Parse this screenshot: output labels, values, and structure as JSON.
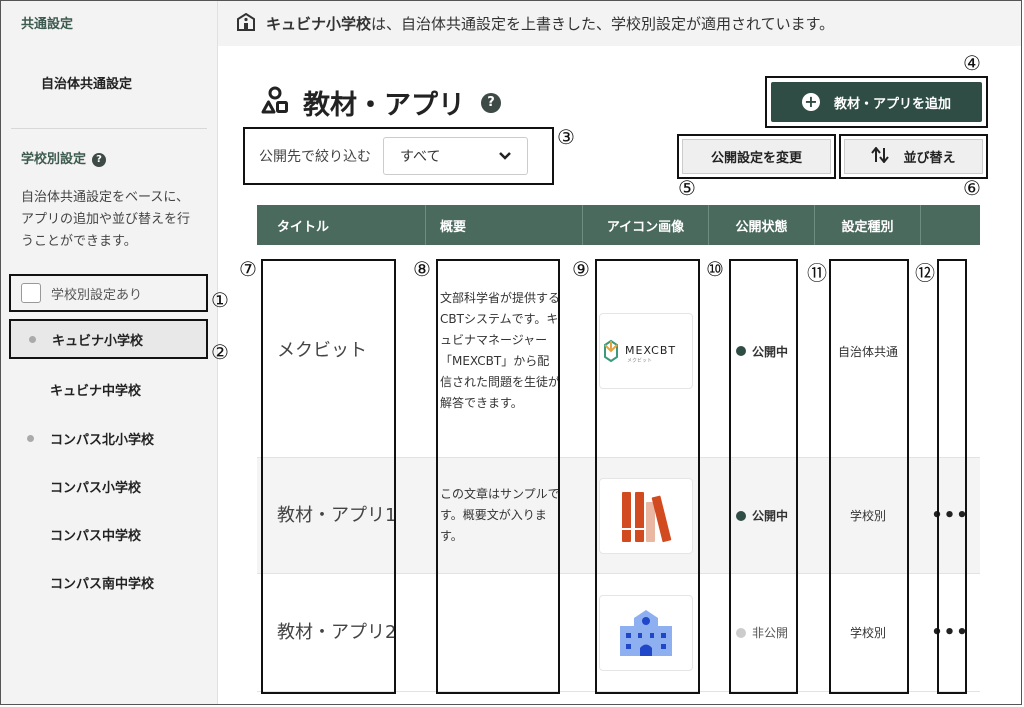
{
  "sidebar": {
    "common_title": "共通設定",
    "common_link": "自治体共通設定",
    "school_title": "学校別設定",
    "help_glyph": "?",
    "description": "自治体共通設定をベースに、アプリの追加や並び替えを行うことができます。",
    "filter_checkbox_label": "学校別設定あり",
    "schools": [
      {
        "name": "キュビナ小学校",
        "has_setting": true,
        "active": true
      },
      {
        "name": "キュビナ中学校",
        "has_setting": false,
        "active": false
      },
      {
        "name": "コンパス北小学校",
        "has_setting": true,
        "active": false
      },
      {
        "name": "コンパス小学校",
        "has_setting": false,
        "active": false
      },
      {
        "name": "コンパス中学校",
        "has_setting": false,
        "active": false
      },
      {
        "name": "コンパス南中学校",
        "has_setting": false,
        "active": false
      }
    ]
  },
  "banner": {
    "school": "キュビナ小学校",
    "message": "は、自治体共通設定を上書きした、学校別設定が適用されています。"
  },
  "page": {
    "title": "教材・アプリ",
    "help_glyph": "?"
  },
  "toolbar": {
    "add_label": "教材・アプリを追加",
    "filter_label": "公開先で絞り込む",
    "filter_value": "すべて",
    "visibility_label": "公開設定を変更",
    "sort_label": "並び替え"
  },
  "table": {
    "headers": [
      "タイトル",
      "概要",
      "アイコン画像",
      "公開状態",
      "設定種別",
      ""
    ],
    "rows": [
      {
        "title": "メクビット",
        "description": "文部科学省が提供するCBTシステムです。キュビナマネージャー「MEXCBT」から配信された問題を生徒が解答できます。",
        "icon": "mexcbt-logo-icon",
        "icon_text": "MEXCBT",
        "icon_subtext": "メクビット",
        "status": "公開中",
        "status_public": true,
        "type": "自治体共通",
        "has_menu": false
      },
      {
        "title": "教材・アプリ1",
        "description": "この文章はサンプルです。概要文が入ります。",
        "icon": "books-icon",
        "status": "公開中",
        "status_public": true,
        "type": "学校別",
        "has_menu": true
      },
      {
        "title": "教材・アプリ2",
        "description": "",
        "icon": "school-building-icon",
        "status": "非公開",
        "status_public": false,
        "type": "学校別",
        "has_menu": true
      }
    ],
    "menu_glyph": "•••"
  },
  "annotations": [
    "①",
    "②",
    "③",
    "④",
    "⑤",
    "⑥",
    "⑦",
    "⑧",
    "⑨",
    "⑩",
    "⑪",
    "⑫"
  ],
  "colors": {
    "primary": "#2f4d44",
    "header": "#4b6a5e",
    "status_public": "#2f4d44",
    "status_private": "#cccccc"
  }
}
